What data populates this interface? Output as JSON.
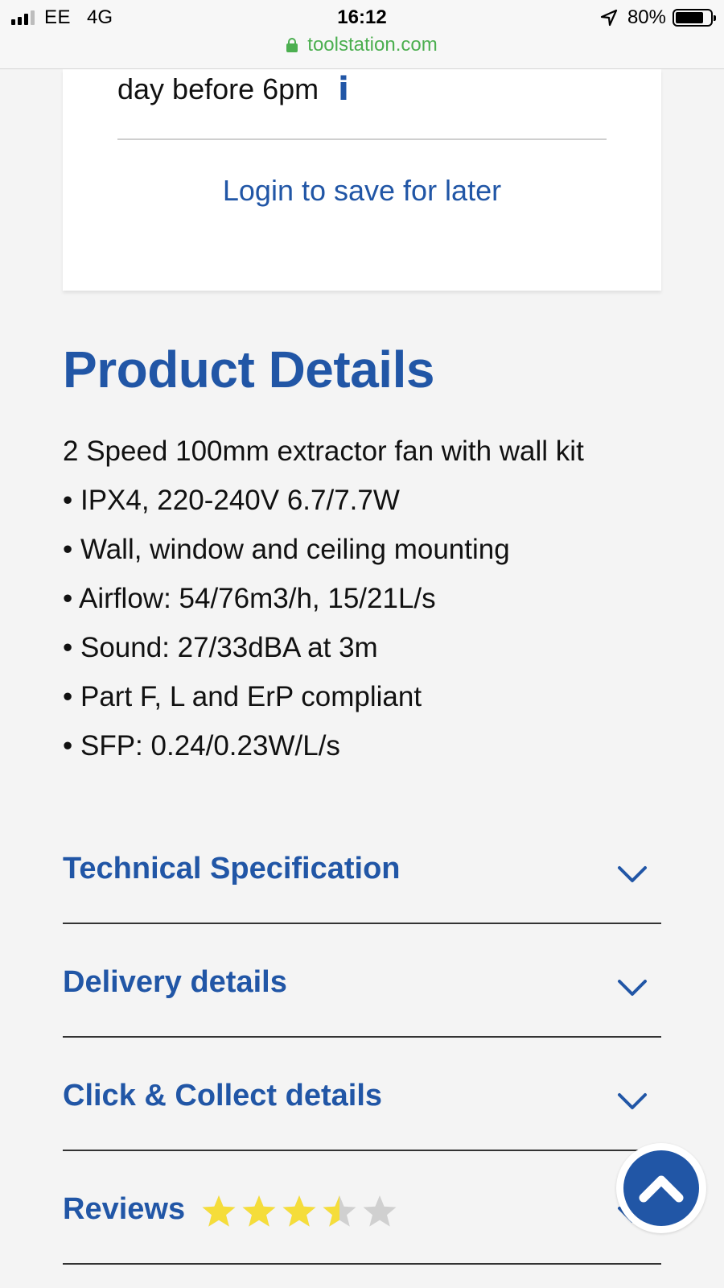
{
  "status_bar": {
    "carrier": "EE",
    "network": "4G",
    "time": "16:12",
    "battery": "80%",
    "battery_level": 0.8,
    "url": "toolstation.com"
  },
  "card": {
    "delivery_note": "day before 6pm",
    "info_icon": "i",
    "login_link": "Login to save for later"
  },
  "product_details": {
    "title": "Product Details",
    "description": "2 Speed 100mm extractor fan with wall kit",
    "bullets": [
      "IPX4, 220-240V 6.7/7.7W",
      "Wall, window and ceiling mounting",
      "Airflow: 54/76m3/h, 15/21L/s",
      "Sound: 27/33dBA at 3m",
      "Part F, L and ErP compliant",
      "SFP: 0.24/0.23W/L/s"
    ]
  },
  "accordion": [
    {
      "title": "Technical Specification"
    },
    {
      "title": "Delivery details"
    },
    {
      "title": "Click & Collect details"
    },
    {
      "title": "Reviews",
      "rating": 3.5,
      "max_rating": 5
    }
  ],
  "colors": {
    "brand_blue": "#2156a6",
    "star_gold": "#f5dd3a",
    "star_empty": "#d0d0d0",
    "secure_green": "#4caf50"
  }
}
